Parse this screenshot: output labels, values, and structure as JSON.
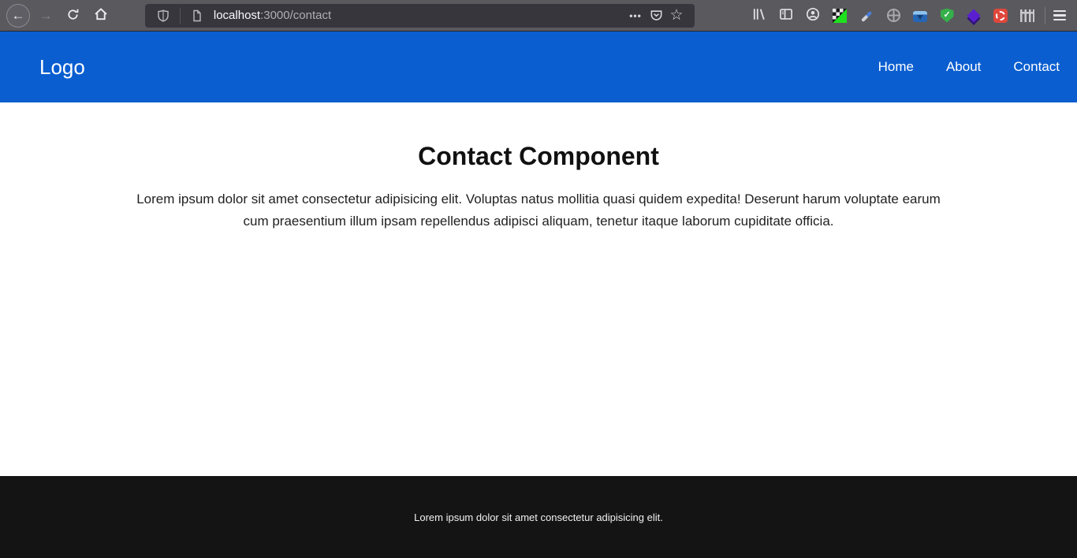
{
  "theme": {
    "navbar_bg": "#0a5ed0",
    "footer_bg": "#141414",
    "toolbar_bg": "#5a595e",
    "urlbar_bg": "#37363d",
    "page_bg": "#ffffff"
  },
  "browser": {
    "url": {
      "host": "localhost",
      "path": ":3000/contact"
    },
    "glyphs": {
      "back": "←",
      "forward": "→",
      "bookmark_star": "☆",
      "page_actions": "•••",
      "check": "✓"
    }
  },
  "navbar": {
    "brand": "Logo",
    "links": [
      {
        "label": "Home"
      },
      {
        "label": "About"
      },
      {
        "label": "Contact"
      }
    ]
  },
  "main": {
    "heading": "Contact Component",
    "paragraph": "Lorem ipsum dolor sit amet consectetur adipisicing elit. Voluptas natus mollitia quasi quidem expedita! Deserunt harum voluptate earum cum praesentium illum ipsam repellendus adipisci aliquam, tenetur itaque laborum cupiditate officia."
  },
  "footer": {
    "text": "Lorem ipsum dolor sit amet consectetur adipisicing elit."
  }
}
